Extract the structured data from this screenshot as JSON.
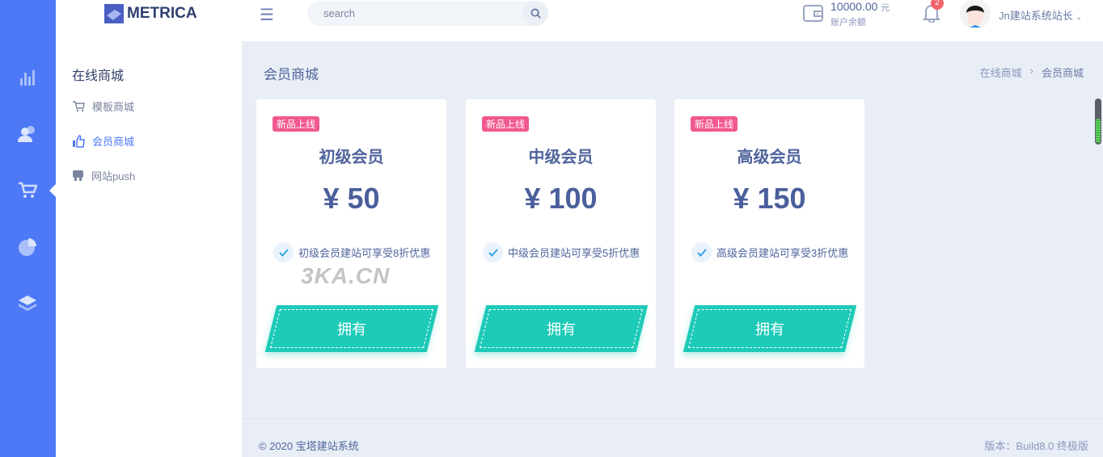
{
  "app": {
    "name": "METRICA",
    "search_placeholder": "search"
  },
  "header": {
    "balance": "10000.00",
    "currency": "元",
    "balance_label": "账户余额",
    "notifications": "2",
    "user": "Jn建站系统站长"
  },
  "rail": {
    "icons": [
      "bar-chart-icon",
      "users-icon",
      "cart-icon",
      "pie-chart-icon",
      "layers-icon"
    ],
    "active": "cart-icon"
  },
  "submenu": {
    "title": "在线商城",
    "items": [
      {
        "label": "模板商城",
        "icon": "cart-icon"
      },
      {
        "label": "会员商城",
        "icon": "thumbs-up-icon",
        "active": true
      },
      {
        "label": "网站push",
        "icon": "push-icon"
      }
    ]
  },
  "page": {
    "title": "会员商城",
    "breadcrumb": [
      "在线商城",
      "会员商城"
    ]
  },
  "cards": [
    {
      "tag": "新品上线",
      "name": "初级会员",
      "price": "¥ 50",
      "feature": "初级会员建站可享受8折优惠",
      "button": "拥有"
    },
    {
      "tag": "新品上线",
      "name": "中级会员",
      "price": "¥ 100",
      "feature": "中级会员建站可享受5折优惠",
      "button": "拥有"
    },
    {
      "tag": "新品上线",
      "name": "高级会员",
      "price": "¥ 150",
      "feature": "高级会员建站可享受3折优惠",
      "button": "拥有"
    }
  ],
  "watermark": "3KA.CN",
  "footer": {
    "copyright": "© 2020 宝塔建站系统",
    "version": "版本：Build8.0 终极版"
  },
  "colors": {
    "rail": "#4d79f6",
    "accent": "#1ecab8",
    "tag": "#f1588f",
    "badge": "#f1646c"
  }
}
